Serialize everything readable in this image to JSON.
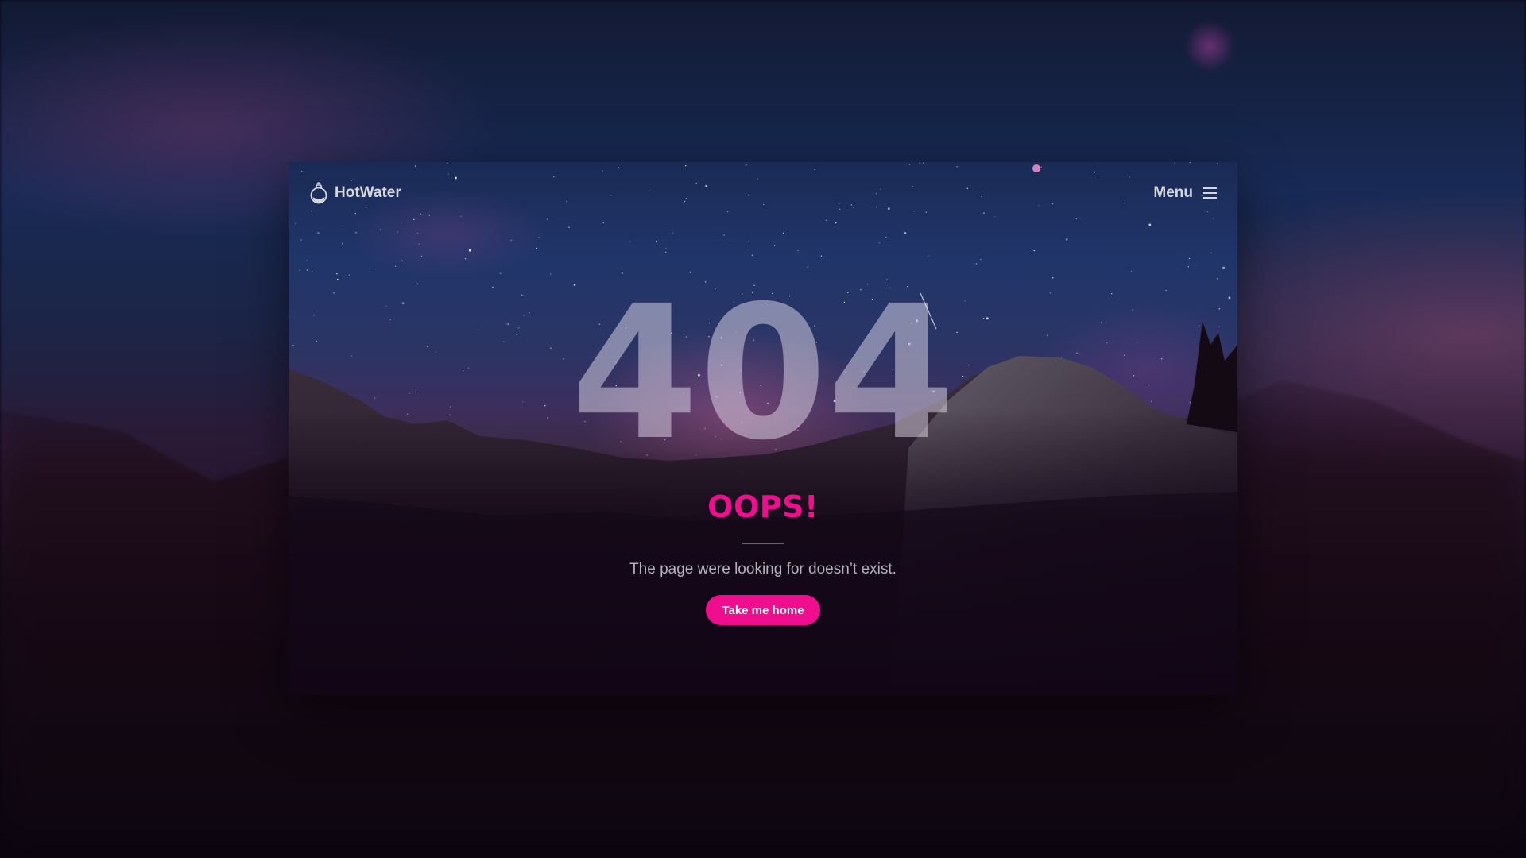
{
  "brand": {
    "name": "HotWater",
    "icon": "kettle-icon"
  },
  "nav": {
    "menu_label": "Menu",
    "menu_icon": "hamburger-icon"
  },
  "error": {
    "code": "404",
    "title": "OOPS!",
    "message": "The page were looking for doesn’t exist.",
    "button_label": "Take me home"
  },
  "colors": {
    "accent": "#ee0e8e",
    "text_light": "#d6d6de",
    "muted": "#b4b0bb"
  }
}
